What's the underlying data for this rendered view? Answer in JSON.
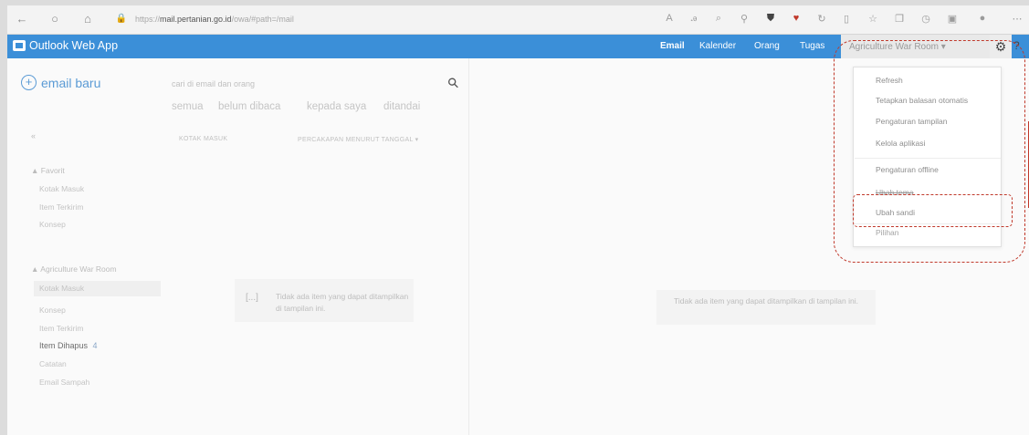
{
  "browser": {
    "back": "←",
    "refresh": "○",
    "home": "⌂",
    "url_prefix": "https://",
    "url_domain": "mail.pertanian.go.id",
    "url_path": "/owa/#path=/mail"
  },
  "app": {
    "title": "Outlook Web App",
    "nav": [
      "Email",
      "Kalender",
      "Orang",
      "Tugas"
    ],
    "account": "Agriculture War Room"
  },
  "folders": {
    "new_mail": "email baru",
    "favorites_header": "▲ Favorit",
    "favorites": [
      "Kotak Masuk",
      "Item Terkirim",
      "Konsep"
    ],
    "account_header": "▲ Agriculture War Room",
    "account_folders": [
      "Kotak Masuk",
      "Konsep",
      "Item Terkirim",
      "Item Dihapus",
      "Catatan",
      "Email Sampah"
    ],
    "deleted_count": "4"
  },
  "list": {
    "search_placeholder": "cari di email dan orang",
    "filters": [
      "semua",
      "belum dibaca",
      "kepada saya",
      "ditandai"
    ],
    "col_inbox": "KOTAK MASUK",
    "col_sort": "PERCAKAPAN MENURUT TANGGAL ▾",
    "empty": "Tidak ada item yang dapat ditampilkan di tampilan ini."
  },
  "reading": {
    "empty": "Tidak ada item yang dapat ditampilkan di tampilan ini."
  },
  "menu": {
    "items": [
      "Refresh",
      "Tetapkan balasan otomatis",
      "Pengaturan tampilan",
      "Kelola aplikasi"
    ],
    "offline": "Pengaturan offline",
    "struck": "Ubah tema",
    "change_password": "Ubah sandi",
    "options": "Pilihan"
  }
}
